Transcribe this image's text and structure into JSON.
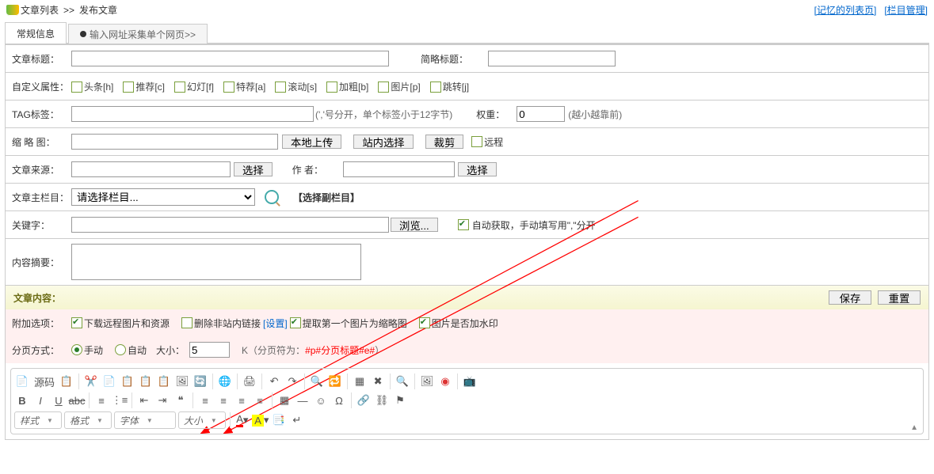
{
  "breadcrumb": {
    "list": "文章列表",
    "sep": ">>",
    "page": "发布文章"
  },
  "top_links": {
    "memory": "[记忆的列表页]",
    "catmgr": "[栏目管理]"
  },
  "tabs": {
    "normal": "常规信息",
    "collect": "输入网址采集单个网页>>"
  },
  "labels": {
    "title": "文章标题：",
    "short": "简略标题：",
    "custom": "自定义属性：",
    "tag": "TAG标签：",
    "tag_hint": "(','号分开，单个标签小于12字节)",
    "weight": "权重：",
    "weight_hint": "(越小越靠前)",
    "thumb": "缩 略 图：",
    "upload": "本地上传",
    "station": "站内选择",
    "crop": "裁剪",
    "remote": "远程",
    "source": "文章来源：",
    "select": "选择",
    "author": "作 者：",
    "maincol": "文章主栏目：",
    "maincol_placeholder": "请选择栏目...",
    "subcol": "【选择副栏目】",
    "keyword": "关键字：",
    "browse": "浏览...",
    "autoget": "自动获取，手动填写用\",\"分开",
    "summary": "内容摘要：",
    "content": "文章内容：",
    "save": "保存",
    "reset": "重置",
    "options": "附加选项：",
    "download": "下载远程图片和资源",
    "dellink": "删除非站内链接",
    "settings": "[设置]",
    "extract": "提取第一个图片为缩略图",
    "watermark": "图片是否加水印",
    "paging": "分页方式：",
    "manual": "手动",
    "auto": "自动",
    "size": "大小：",
    "pagefmt_pre": "K（分页符为：",
    "pagefmt_red": "#p#分页标题#e#",
    "pagefmt_post": " ）"
  },
  "values": {
    "weight": "0",
    "size": "5"
  },
  "attrs": {
    "h": "头条[h]",
    "c": "推荐[c]",
    "f": "幻灯[f]",
    "a": "特荐[a]",
    "s": "滚动[s]",
    "b": "加粗[b]",
    "p": "图片[p]",
    "j": "跳转[j]"
  },
  "editor": {
    "source": "源码",
    "styles": "样式",
    "format": "格式",
    "font": "字体",
    "fsize": "大小"
  }
}
